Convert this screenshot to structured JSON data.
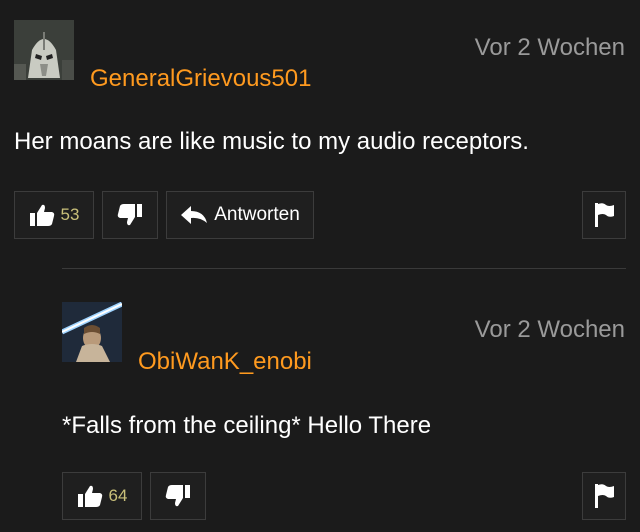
{
  "comments": [
    {
      "username": "GeneralGrievous501",
      "timestamp": "Vor 2 Wochen",
      "text": "Her moans are like music to my audio receptors.",
      "likes": "53",
      "reply_label": "Antworten",
      "avatar_icon": "robot-general-avatar"
    },
    {
      "username": "ObiWanK_enobi",
      "timestamp": "Vor 2 Wochen",
      "text": "*Falls from the ceiling* Hello There",
      "likes": "64",
      "avatar_icon": "jedi-lightsaber-avatar"
    }
  ],
  "colors": {
    "background": "#1b1b1b",
    "username": "#ff9a1f",
    "timestamp": "#9a9a9a",
    "count": "#c9c07a",
    "button_border": "#3c3c3c"
  }
}
